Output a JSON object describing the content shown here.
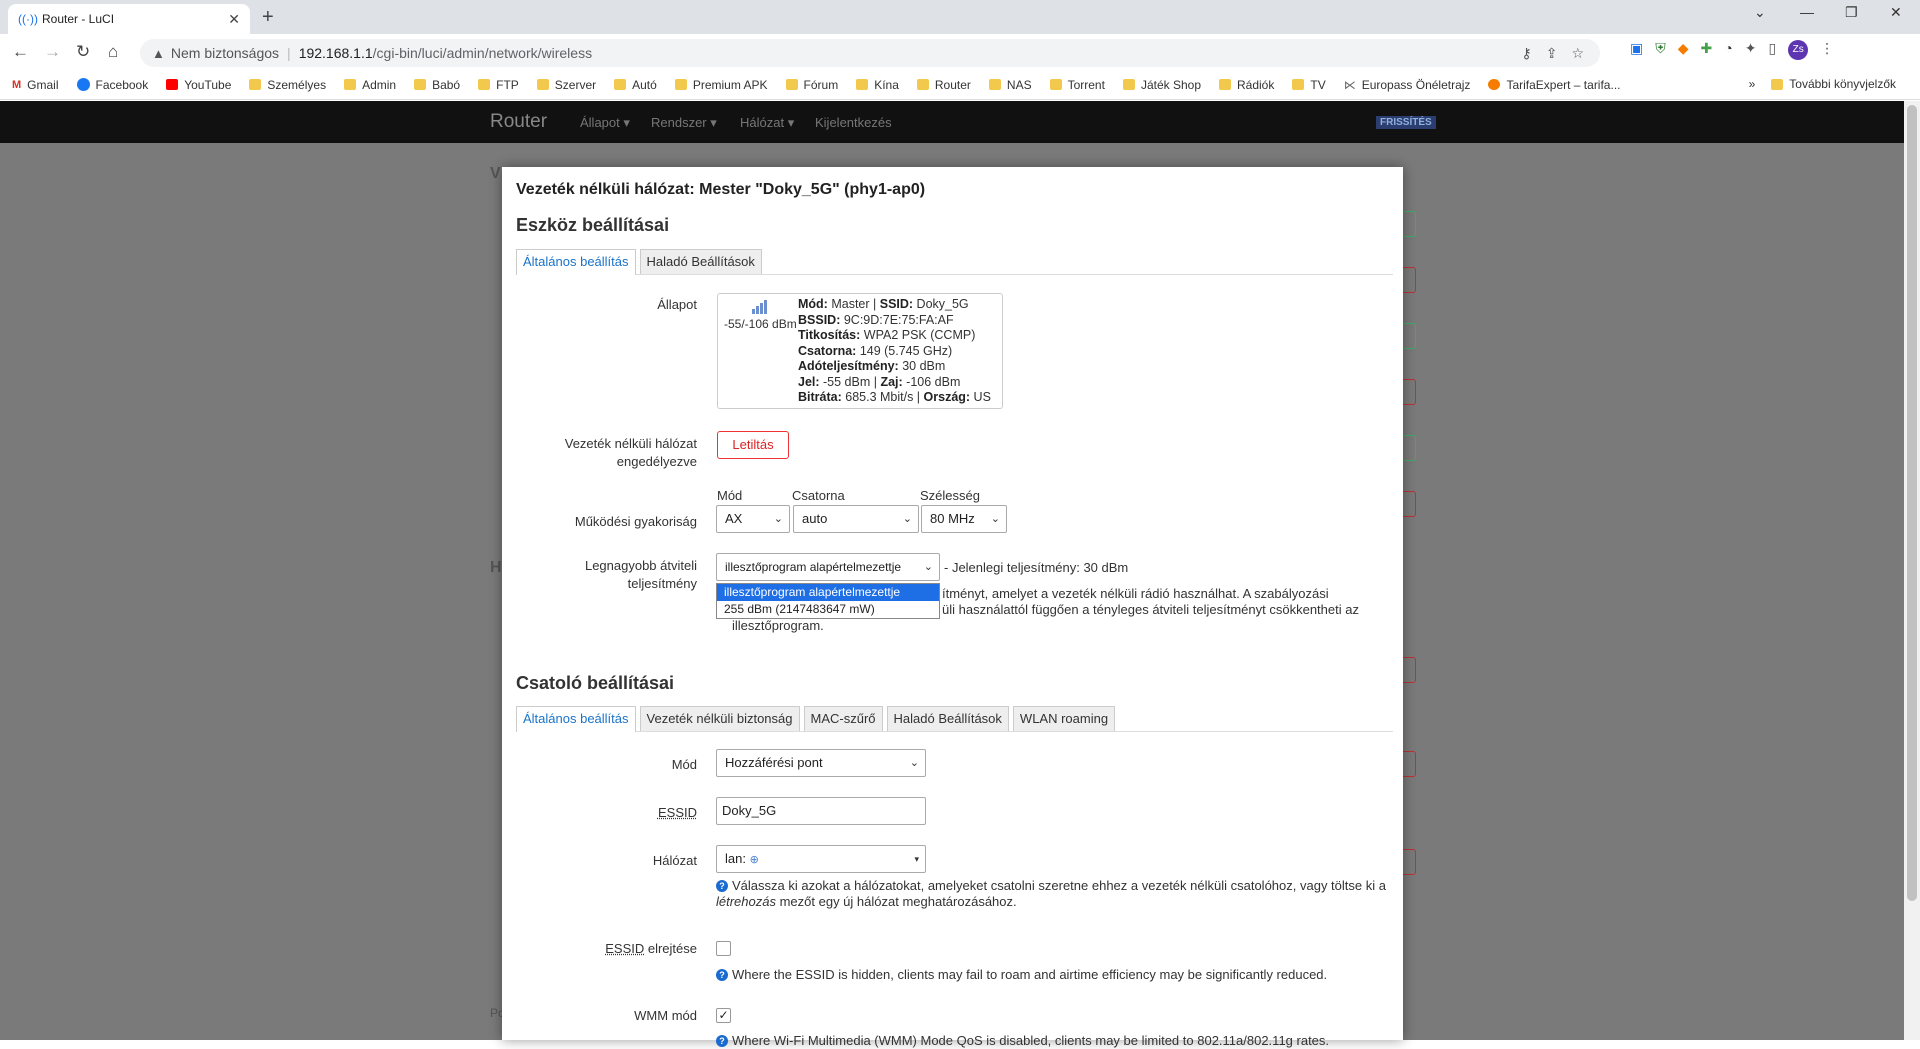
{
  "browser": {
    "tab_title": "Router - LuCI",
    "tab_close": "✕",
    "new_tab": "+",
    "window_controls": [
      "⌄",
      "—",
      "❐",
      "✕"
    ],
    "security_label": "Nem biztonságos",
    "url_host": "192.168.1.1",
    "url_path": "/cgi-bin/luci/admin/network/wireless",
    "profile_initials": "Zs"
  },
  "bookmarks": {
    "items": [
      "Gmail",
      "Facebook",
      "YouTube",
      "Személyes",
      "Admin",
      "Babó",
      "FTP",
      "Szerver",
      "Autó",
      "Premium APK",
      "Fórum",
      "Kína",
      "Router",
      "NAS",
      "Torrent",
      "Játék Shop",
      "Rádiók",
      "TV",
      "Europass Önéletrajz",
      "TarifaExpert – tarifa..."
    ],
    "more": "»",
    "other": "További könyvjelzők"
  },
  "luci": {
    "brand": "Router",
    "menu": [
      "Állapot",
      "Rendszer",
      "Hálózat",
      "Kijelentkezés"
    ],
    "update_badge": "FRISSÍTÉS",
    "bg_letters": [
      "V",
      "H",
      "Po"
    ]
  },
  "modal": {
    "title": "Vezeték nélküli hálózat: Mester \"Doky_5G\" (phy1-ap0)",
    "device_section": "Eszköz beállításai",
    "device_tabs": [
      "Általános beállítás",
      "Haladó Beállítások"
    ],
    "status_label": "Állapot",
    "signal_text": "-55/-106 dBm",
    "status_lines": [
      {
        "k1": "Mód:",
        "v1": " Master | ",
        "k2": "SSID:",
        "v2": " Doky_5G"
      },
      {
        "k1": "BSSID:",
        "v1": " 9C:9D:7E:75:FA:AF",
        "k2": "",
        "v2": ""
      },
      {
        "k1": "Titkosítás:",
        "v1": " WPA2 PSK (CCMP)",
        "k2": "",
        "v2": ""
      },
      {
        "k1": "Csatorna:",
        "v1": " 149 (5.745 GHz)",
        "k2": "",
        "v2": ""
      },
      {
        "k1": "Adóteljesítmény:",
        "v1": " 30 dBm",
        "k2": "",
        "v2": ""
      },
      {
        "k1": "Jel:",
        "v1": " -55 dBm | ",
        "k2": "Zaj:",
        "v2": " -106 dBm"
      },
      {
        "k1": "Bitráta:",
        "v1": " 685.3 Mbit/s | ",
        "k2": "Ország:",
        "v2": " US"
      }
    ],
    "wifi_enabled_label": "Vezeték nélküli hálózat engedélyezve",
    "disable_button": "Letiltás",
    "freq_label": "Működési gyakoriság",
    "mode_hdr": "Mód",
    "channel_hdr": "Csatorna",
    "width_hdr": "Szélesség",
    "mode_value": "AX",
    "channel_value": "auto",
    "width_value": "80 MHz",
    "txpower_label": "Legnagyobb átviteli teljesítmény",
    "txpower_value": "illesztőprogram alapértelmezettje",
    "txpower_current": "- Jelenlegi teljesítmény: 30 dBm",
    "txpower_note_1": "ítményt, amelyet a vezeték nélküli rádió használhat. A szabályozási",
    "txpower_note_2": "üli használattól függően a tényleges átviteli teljesítményt csökkentheti az",
    "txpower_note_3": "illesztőprogram.",
    "txpower_options": [
      "illesztőprogram alapértelmezettje",
      "255 dBm (2147483647 mW)"
    ],
    "iface_section": "Csatoló beállításai",
    "iface_tabs": [
      "Általános beállítás",
      "Vezeték nélküli biztonság",
      "MAC-szűrő",
      "Haladó Beállítások",
      "WLAN roaming"
    ],
    "mode_label": "Mód",
    "mode_select": "Hozzáférési pont",
    "essid_label": "ESSID",
    "essid_value": "Doky_5G",
    "network_label": "Hálózat",
    "network_value": "lan:",
    "network_help": "Válassza ki azokat a hálózatokat, amelyeket csatolni szeretne ehhez a vezeték nélküli csatolóhoz, vagy töltse ki a",
    "network_help_em": "létrehozás",
    "network_help_2": " mezőt egy új hálózat meghatározásához.",
    "hide_label_u": "ESSID",
    "hide_label_rest": " elrejtése",
    "hide_help": "Where the ESSID is hidden, clients may fail to roam and airtime efficiency may be significantly reduced.",
    "wmm_label": "WMM mód",
    "wmm_check": "✓",
    "wmm_help": "Where Wi-Fi Multimedia (WMM) Mode QoS is disabled, clients may be limited to 802.11a/802.11g rates."
  }
}
